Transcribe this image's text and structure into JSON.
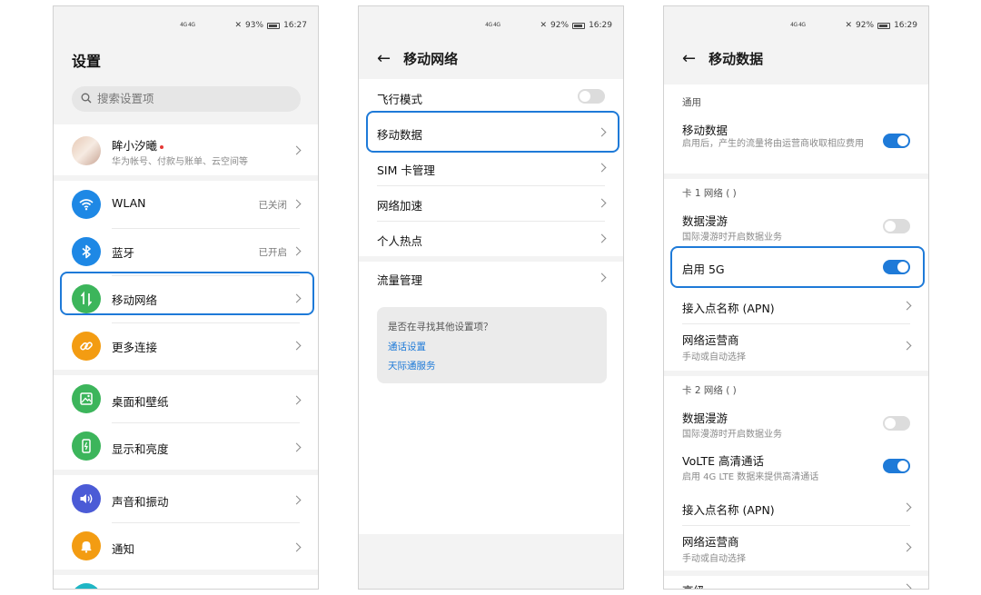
{
  "status": [
    {
      "network": "4G 4G",
      "battery": "93%",
      "time": "16:27"
    },
    {
      "network": "4G 4G",
      "battery": "92%",
      "time": "16:29"
    },
    {
      "network": "4G 4G",
      "battery": "92%",
      "time": "16:29"
    }
  ],
  "screen1": {
    "title": "设置",
    "search_placeholder": "搜索设置项",
    "profile": {
      "name": "眸小汐曦",
      "sub": "华为帐号、付款与账单、云空间等"
    },
    "items": [
      {
        "label": "WLAN",
        "state": "已关闭",
        "icon": "wifi-icon",
        "color": "#1e88e5"
      },
      {
        "label": "蓝牙",
        "state": "已开启",
        "icon": "bluetooth-icon",
        "color": "#1e88e5"
      },
      {
        "label": "移动网络",
        "state": "",
        "icon": "mobile-network-icon",
        "color": "#3cb55b"
      },
      {
        "label": "更多连接",
        "state": "",
        "icon": "link-icon",
        "color": "#f39c12"
      },
      {
        "label": "桌面和壁纸",
        "state": "",
        "icon": "wallpaper-icon",
        "color": "#3cb55b"
      },
      {
        "label": "显示和亮度",
        "state": "",
        "icon": "display-icon",
        "color": "#3cb55b"
      },
      {
        "label": "声音和振动",
        "state": "",
        "icon": "sound-icon",
        "color": "#4b5bd6"
      },
      {
        "label": "通知",
        "state": "",
        "icon": "bell-icon",
        "color": "#f39c12"
      }
    ]
  },
  "screen2": {
    "title": "移动网络",
    "airplane": "飞行模式",
    "items": [
      "移动数据",
      "SIM 卡管理",
      "网络加速",
      "个人热点"
    ],
    "traffic": "流量管理",
    "help_question": "是否在寻找其他设置项？",
    "help_links": [
      "通话设置",
      "天际通服务"
    ]
  },
  "screen3": {
    "title": "移动数据",
    "general": "通用",
    "mobile_data": {
      "label": "移动数据",
      "sub": "启用后，产生的流量将由运营商收取相应费用",
      "on": true
    },
    "card1_header": "卡 1 网络 (                    )",
    "card1": {
      "roaming": {
        "label": "数据漫游",
        "sub": "国际漫游时开启数据业务",
        "on": false
      },
      "enable5g": {
        "label": "启用 5G",
        "on": true
      },
      "apn": "接入点名称 (APN)",
      "carrier": {
        "label": "网络运营商",
        "sub": "手动或自动选择"
      }
    },
    "card2_header": "卡 2 网络 (                    )",
    "card2": {
      "roaming": {
        "label": "数据漫游",
        "sub": "国际漫游时开启数据业务",
        "on": false
      },
      "volte": {
        "label": "VoLTE 高清通话",
        "sub": "启用 4G LTE 数据来提供高清通话",
        "on": true
      },
      "apn": "接入点名称 (APN)",
      "carrier": {
        "label": "网络运营商",
        "sub": "手动或自动选择"
      }
    },
    "advanced": "高级"
  },
  "colors": {
    "accent": "#1e7ad8",
    "highlight": "#1e7ad8"
  }
}
